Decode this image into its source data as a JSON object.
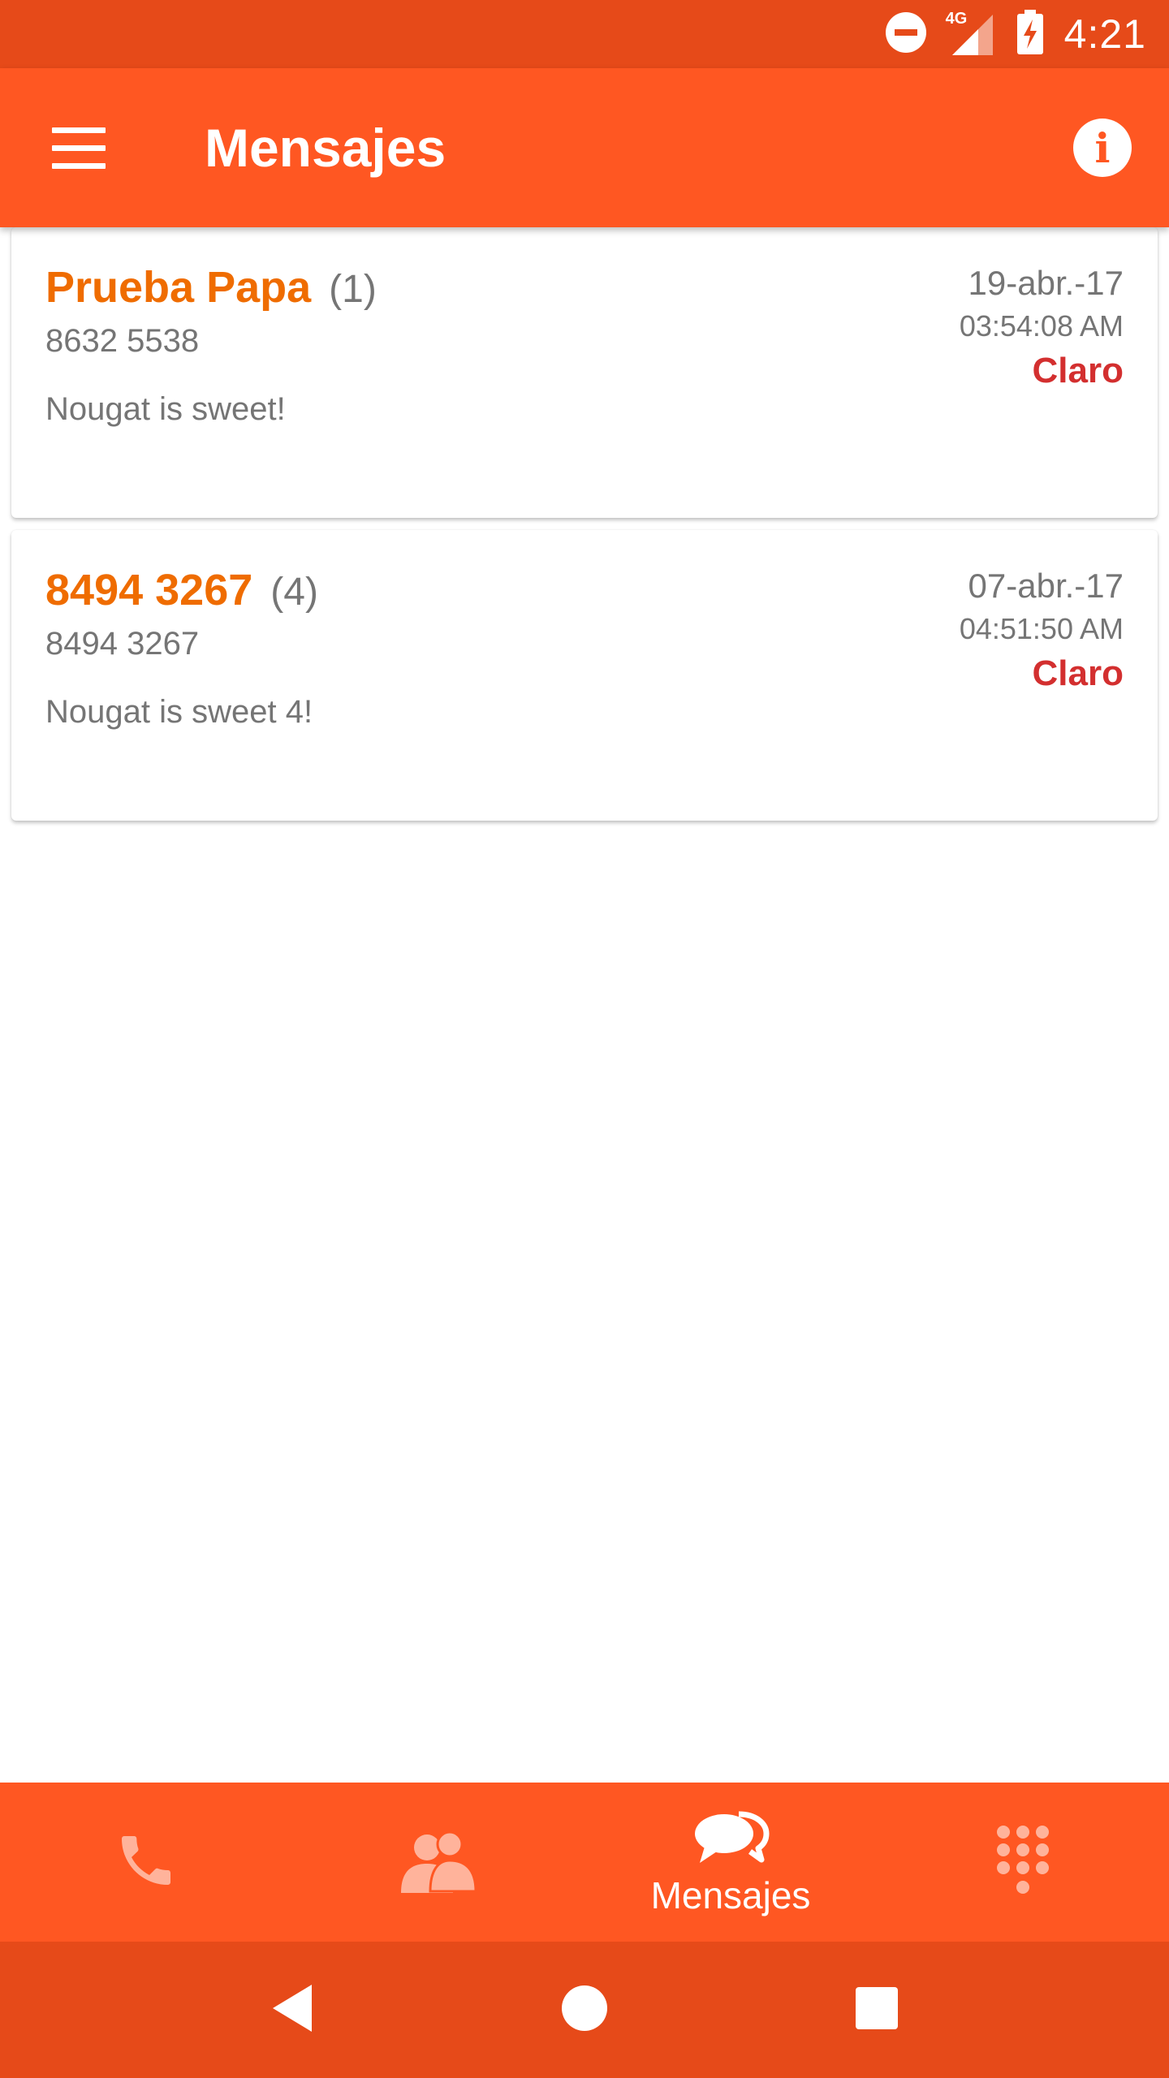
{
  "status_bar": {
    "time": "4:21",
    "network": "4G",
    "icons": [
      "dnd-icon",
      "signal-icon",
      "battery-charging-icon"
    ]
  },
  "app_bar": {
    "title": "Mensajes",
    "menu_icon": "menu-icon",
    "info_icon": "info-icon",
    "info_glyph": "i"
  },
  "messages": [
    {
      "name": "Prueba Papa",
      "count": "(1)",
      "number": "8632 5538",
      "preview": "Nougat is sweet!",
      "date": "19-abr.-17",
      "time": "03:54:08 AM",
      "carrier": "Claro"
    },
    {
      "name": "8494 3267",
      "count": "(4)",
      "number": "8494 3267",
      "preview": "Nougat is sweet 4!",
      "date": "07-abr.-17",
      "time": "04:51:50 AM",
      "carrier": "Claro"
    }
  ],
  "bottom_nav": {
    "items": [
      {
        "icon": "phone-icon",
        "label": "",
        "active": false
      },
      {
        "icon": "contacts-icon",
        "label": "",
        "active": false
      },
      {
        "icon": "messages-icon",
        "label": "Mensajes",
        "active": true
      },
      {
        "icon": "dialpad-icon",
        "label": "",
        "active": false
      }
    ]
  },
  "system_nav": [
    "back-icon",
    "home-icon",
    "recents-icon"
  ],
  "colors": {
    "primary": "#FF5722",
    "primary_dark": "#E64A19",
    "name_accent": "#EF6C00",
    "carrier_red": "#D32F2F",
    "secondary_text": "#757575"
  }
}
